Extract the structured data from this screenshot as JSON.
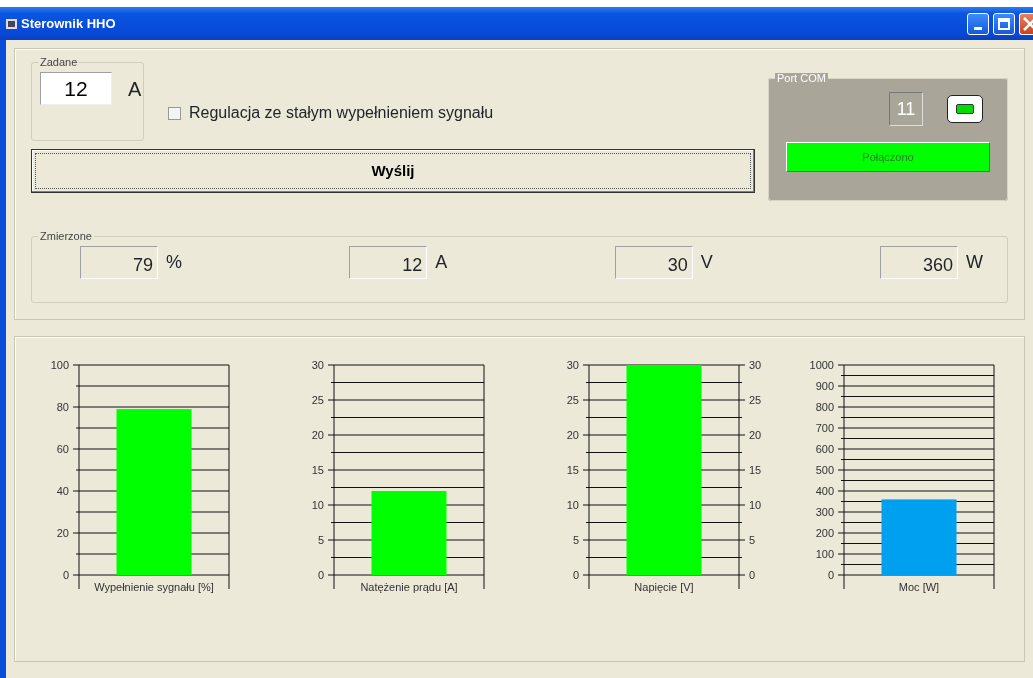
{
  "window": {
    "title": "Sterownik HHO"
  },
  "setpoint": {
    "legend": "Zadane",
    "value": "12",
    "unit": "A"
  },
  "constant_fill_checkbox": {
    "label": "Regulacja ze stałym wypełnieniem sygnału",
    "checked": false
  },
  "send_button": {
    "label": "Wyślij"
  },
  "port_com": {
    "legend": "Port COM",
    "port": "11",
    "status": "Połączono",
    "connected": true
  },
  "measured": {
    "legend": "Zmierzone",
    "readings": [
      {
        "value": "79",
        "unit": "%"
      },
      {
        "value": "12",
        "unit": "A"
      },
      {
        "value": "30",
        "unit": "V"
      },
      {
        "value": "360",
        "unit": "W"
      }
    ]
  },
  "charts": [
    {
      "chart_data": {
        "type": "bar",
        "categories": [
          "Wypełnienie sygnału [%]"
        ],
        "series": [
          {
            "color": "#00ff00",
            "values": [
              79
            ]
          }
        ],
        "ylim": [
          0,
          100
        ],
        "yticks": [
          0,
          20,
          40,
          60,
          80,
          100
        ],
        "grid": true
      }
    },
    {
      "chart_data": {
        "type": "bar",
        "categories": [
          "Natężenie prądu [A]"
        ],
        "series": [
          {
            "color": "#00ff00",
            "values": [
              12
            ]
          }
        ],
        "ylim": [
          0,
          30
        ],
        "yticks": [
          0,
          5,
          10,
          15,
          20,
          25,
          30
        ],
        "grid": true
      }
    },
    {
      "chart_data": {
        "type": "bar",
        "categories": [
          "Napięcie [V]"
        ],
        "series": [
          {
            "color": "#00ff00",
            "values": [
              30
            ]
          }
        ],
        "ylim": [
          0,
          30
        ],
        "yticks": [
          0,
          5,
          10,
          15,
          20,
          25,
          30
        ],
        "grid": true,
        "annotations": [
          "0",
          "5",
          "10",
          "15",
          "20",
          "25",
          "30"
        ]
      }
    },
    {
      "chart_data": {
        "type": "bar",
        "categories": [
          "Moc [W]"
        ],
        "series": [
          {
            "color": "#00a0f0",
            "values": [
              360
            ]
          }
        ],
        "ylim": [
          0,
          1000
        ],
        "yticks": [
          0,
          100,
          200,
          300,
          400,
          500,
          600,
          700,
          800,
          900,
          1000
        ],
        "grid": true
      }
    }
  ]
}
